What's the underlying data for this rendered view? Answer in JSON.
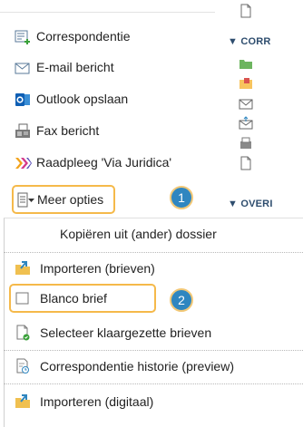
{
  "nav": {
    "items": [
      {
        "label": "Correspondentie",
        "icon": "letter-add-icon"
      },
      {
        "label": "E-mail bericht",
        "icon": "email-icon"
      },
      {
        "label": "Outlook opslaan",
        "icon": "outlook-icon"
      },
      {
        "label": "Fax bericht",
        "icon": "fax-icon"
      },
      {
        "label": "Raadpleeg 'Via Juridica'",
        "icon": "via-juridica-icon"
      }
    ],
    "more_options": {
      "label": "Meer opties",
      "icon": "list-dropdown-icon",
      "badge": "1"
    }
  },
  "tree": {
    "section1": "▼ CORR",
    "section2": "▼ OVERI"
  },
  "dropdown": {
    "items": [
      {
        "label": "Kopiëren uit (ander) dossier"
      },
      {
        "label": "Importeren (brieven)",
        "icon": "import-folder-icon"
      },
      {
        "label": "Blanco brief",
        "icon": "blank-letter-icon",
        "badge": "2"
      },
      {
        "label": "Selecteer klaargezette brieven",
        "icon": "select-document-icon"
      },
      {
        "label": "Correspondentie historie (preview)",
        "icon": "history-document-icon"
      },
      {
        "label": "Importeren (digitaal)",
        "icon": "import-folder-icon"
      }
    ]
  },
  "colors": {
    "highlight": "#f5b94a",
    "badge": "#2f86c0",
    "tree_heading": "#2e4d6e"
  }
}
